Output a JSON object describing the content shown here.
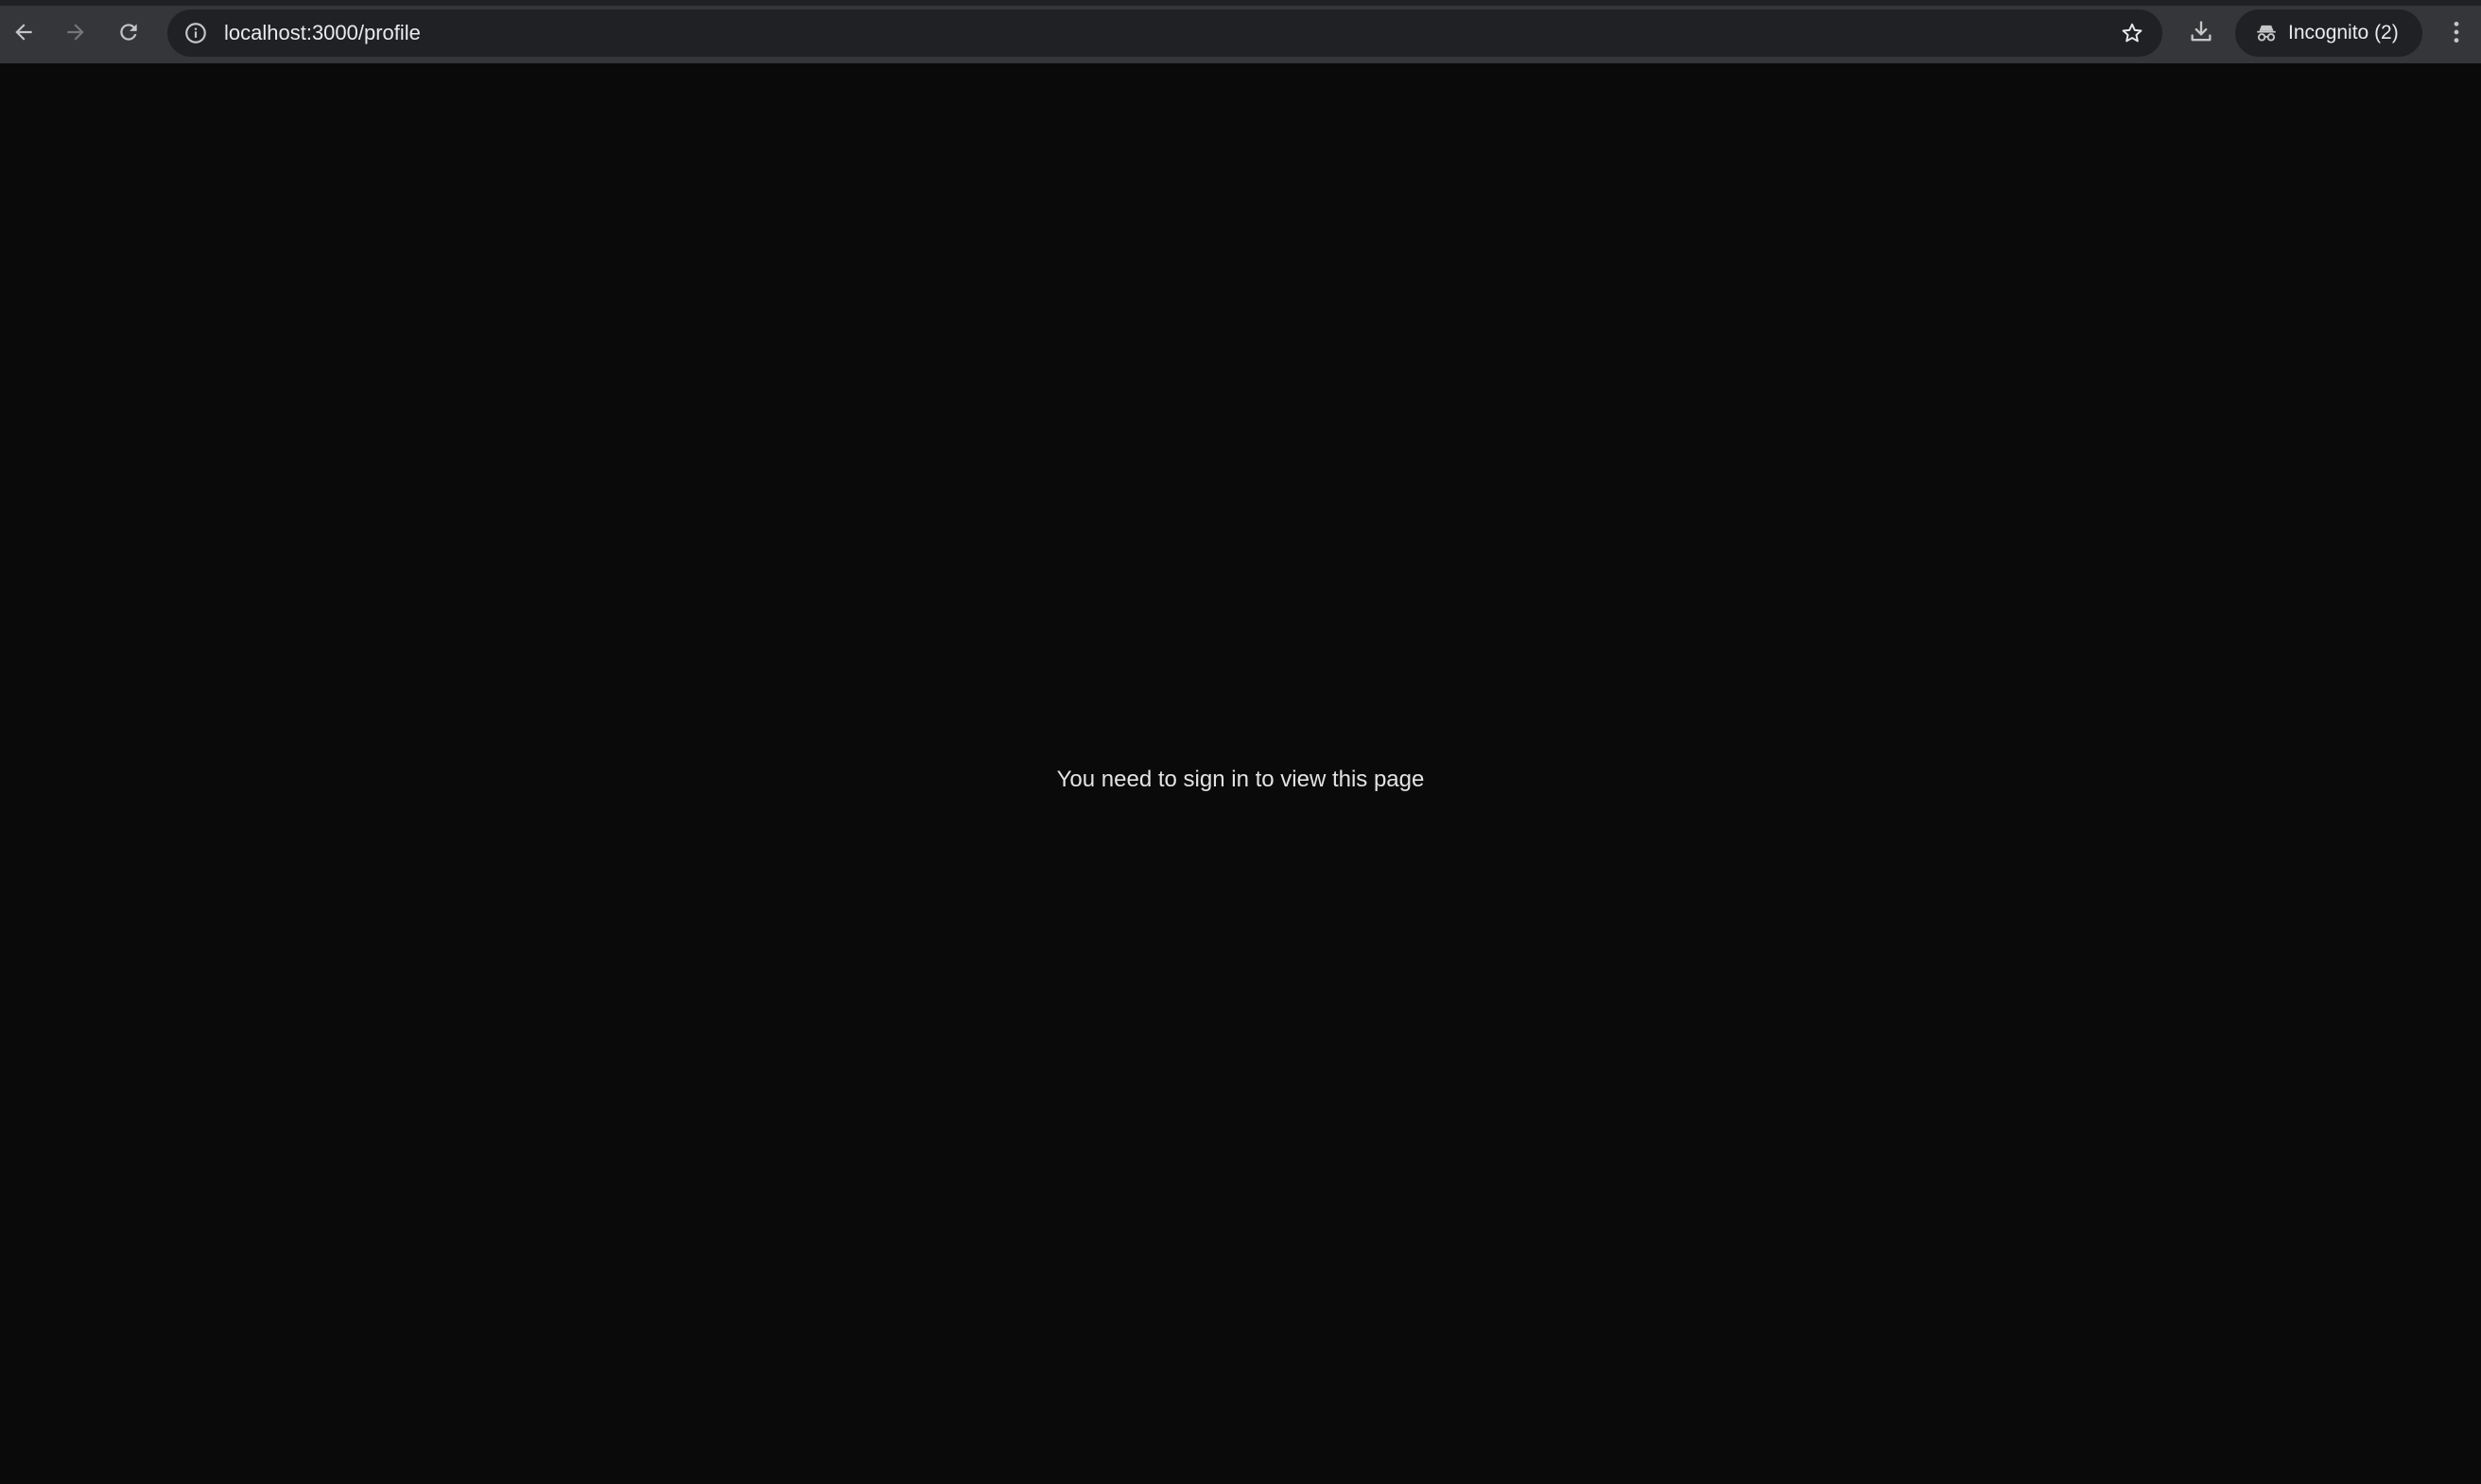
{
  "browser": {
    "url": "localhost:3000/profile",
    "profile_label": "Incognito (2)",
    "icons": {
      "back": "back-arrow-icon",
      "forward": "forward-arrow-icon",
      "reload": "reload-icon",
      "site_info": "info-icon",
      "bookmark": "star-icon",
      "download": "download-icon",
      "incognito": "incognito-icon",
      "menu": "kebab-menu-icon"
    },
    "colors": {
      "toolbar": "#35363a",
      "omnibox": "#202124",
      "text": "#e8eaed"
    }
  },
  "page": {
    "message": "You need to sign in to view this page",
    "colors": {
      "background": "#0a0a0a",
      "text": "#e3e3e3"
    }
  }
}
